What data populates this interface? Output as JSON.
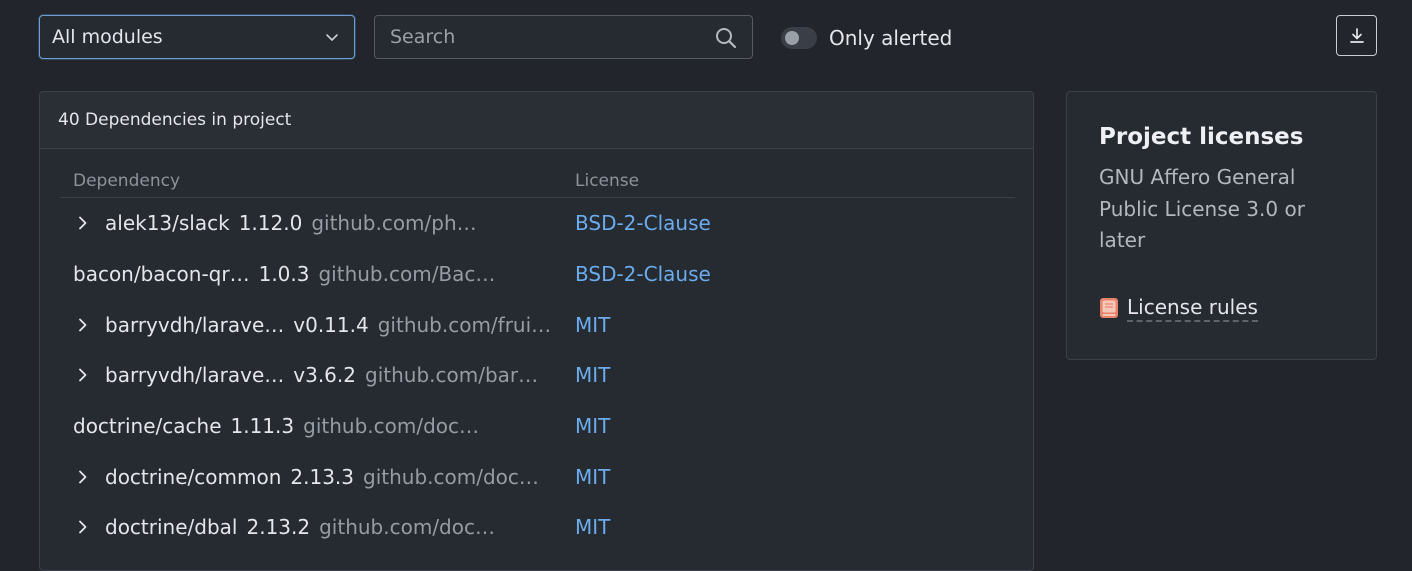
{
  "toolbar": {
    "module_select": {
      "value": "All modules",
      "icon": "chevron-down-icon"
    },
    "search": {
      "placeholder": "Search",
      "value": "",
      "icon": "search-icon"
    },
    "only_alerted": {
      "label": "Only alerted",
      "checked": false
    },
    "export": {
      "icon": "download-icon"
    }
  },
  "dependencies": {
    "header": "40 Dependencies in project",
    "columns": [
      "Dependency",
      "License"
    ],
    "rows": [
      {
        "expandable": true,
        "name": "alek13/slack",
        "version": "1.12.0",
        "source": "github.com/ph…",
        "license": "BSD-2-Clause"
      },
      {
        "expandable": false,
        "name": "bacon/bacon-qr…",
        "version": "1.0.3",
        "source": "github.com/Bac…",
        "license": "BSD-2-Clause"
      },
      {
        "expandable": true,
        "name": "barryvdh/larave…",
        "version": "v0.11.4",
        "source": "github.com/frui…",
        "license": "MIT"
      },
      {
        "expandable": true,
        "name": "barryvdh/larave…",
        "version": "v3.6.2",
        "source": "github.com/bar…",
        "license": "MIT"
      },
      {
        "expandable": false,
        "name": "doctrine/cache",
        "version": "1.11.3",
        "source": "github.com/doc…",
        "license": "MIT"
      },
      {
        "expandable": true,
        "name": "doctrine/common",
        "version": "2.13.3",
        "source": "github.com/doc…",
        "license": "MIT"
      },
      {
        "expandable": true,
        "name": "doctrine/dbal",
        "version": "2.13.2",
        "source": "github.com/doc…",
        "license": "MIT"
      }
    ]
  },
  "project_licenses": {
    "title": "Project licenses",
    "license": "GNU Affero General Public License 3.0 or later",
    "rules_link": "License rules",
    "rules_icon": "book-icon"
  },
  "colors": {
    "background": "#22252b",
    "card": "#262a31",
    "link": "#6aacee",
    "focus_border": "#6b9fd6"
  }
}
